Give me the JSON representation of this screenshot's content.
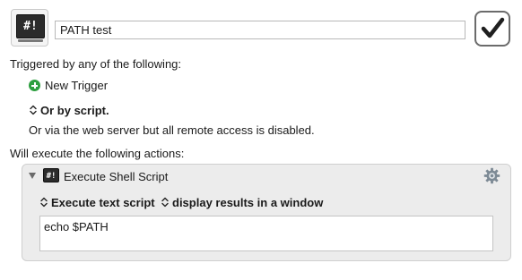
{
  "macro": {
    "icon": {
      "name": "shell-script-icon",
      "glyph": "#!"
    },
    "name": "PATH test",
    "enabled": true
  },
  "triggers": {
    "heading": "Triggered by any of the following:",
    "new_trigger_label": "New Trigger",
    "or_by_script_label": "Or by script.",
    "web_server_note": "Or via the web server but all remote access is disabled."
  },
  "actions": {
    "heading": "Will execute the following actions:",
    "items": [
      {
        "title": "Execute Shell Script",
        "icon": {
          "name": "shell-script-icon",
          "glyph": "#!"
        },
        "source_popup": "Execute text script",
        "output_popup": "display results in a window",
        "script_text": "echo $PATH"
      }
    ]
  },
  "colors": {
    "trigger_green": "#2e9f40",
    "action_bg": "#ececec"
  }
}
